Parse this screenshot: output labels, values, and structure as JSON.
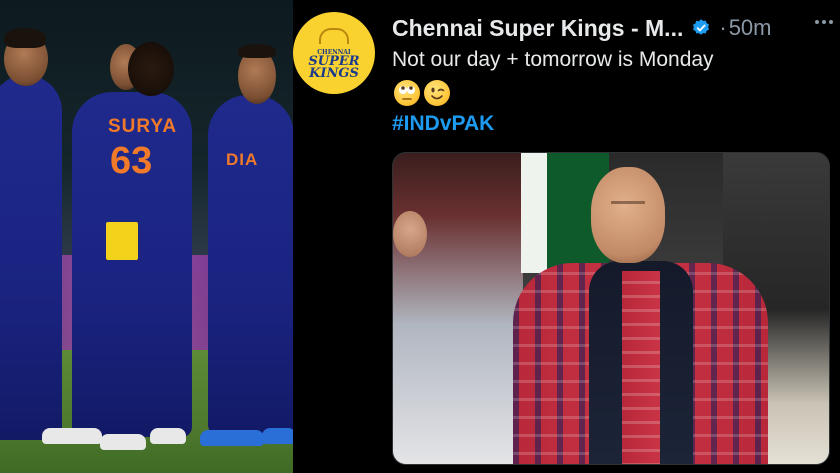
{
  "left_photo": {
    "jersey_name": "SURYA",
    "jersey_number": "63",
    "jersey_partial": "DIA"
  },
  "tweet": {
    "author_name": "Chennai Super Kings - M...",
    "verified_icon": "verified-badge-icon",
    "separator": "·",
    "timestamp": "50m",
    "more_icon": "ellipsis-icon",
    "text": "Not our day + tomorrow is Monday",
    "emojis": [
      "rolling-eyes-emoji",
      "wink-emoji"
    ],
    "hashtag": "#INDvPAK",
    "avatar": {
      "label_line1": "SUPER",
      "label_line2": "KINGS",
      "label_top": "CHENNAI"
    },
    "colors": {
      "background": "#000000",
      "text": "#e7e9ea",
      "muted": "#8b98a5",
      "link": "#1d9bf0",
      "verified": "#1d9bf0",
      "avatar_bg": "#f9d230"
    }
  }
}
